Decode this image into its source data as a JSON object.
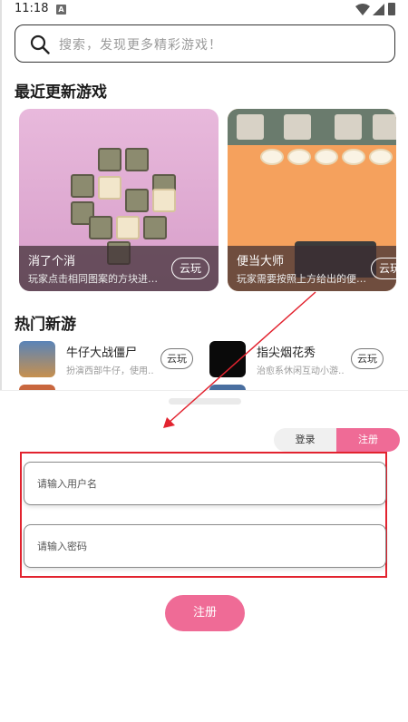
{
  "status_bar": {
    "time": "11:18",
    "notification_icon": "A"
  },
  "search": {
    "placeholder": "搜索，发现更多精彩游戏！"
  },
  "recent": {
    "title": "最近更新游戏",
    "cards": [
      {
        "name": "消了个消",
        "desc": "玩家点击相同图案的方块进…",
        "play_label": "云玩"
      },
      {
        "name": "便当大师",
        "desc": "玩家需要按照上方给出的便…",
        "play_label": "云玩"
      }
    ]
  },
  "hot": {
    "title": "热门新游",
    "items": [
      {
        "name": "牛仔大战僵尸",
        "desc": "扮演西部牛仔，使用…",
        "play_label": "云玩"
      },
      {
        "name": "指尖烟花秀",
        "desc": "治愈系休闲互动小游…",
        "play_label": "云玩"
      }
    ]
  },
  "auth": {
    "tabs": {
      "login": "登录",
      "register": "注册"
    },
    "username_placeholder": "请输入用户名",
    "password_placeholder": "请输入密码",
    "submit_label": "注册"
  },
  "colors": {
    "accent": "#ef6b96",
    "highlight": "#e2232f",
    "annotation": "#e2232f"
  }
}
